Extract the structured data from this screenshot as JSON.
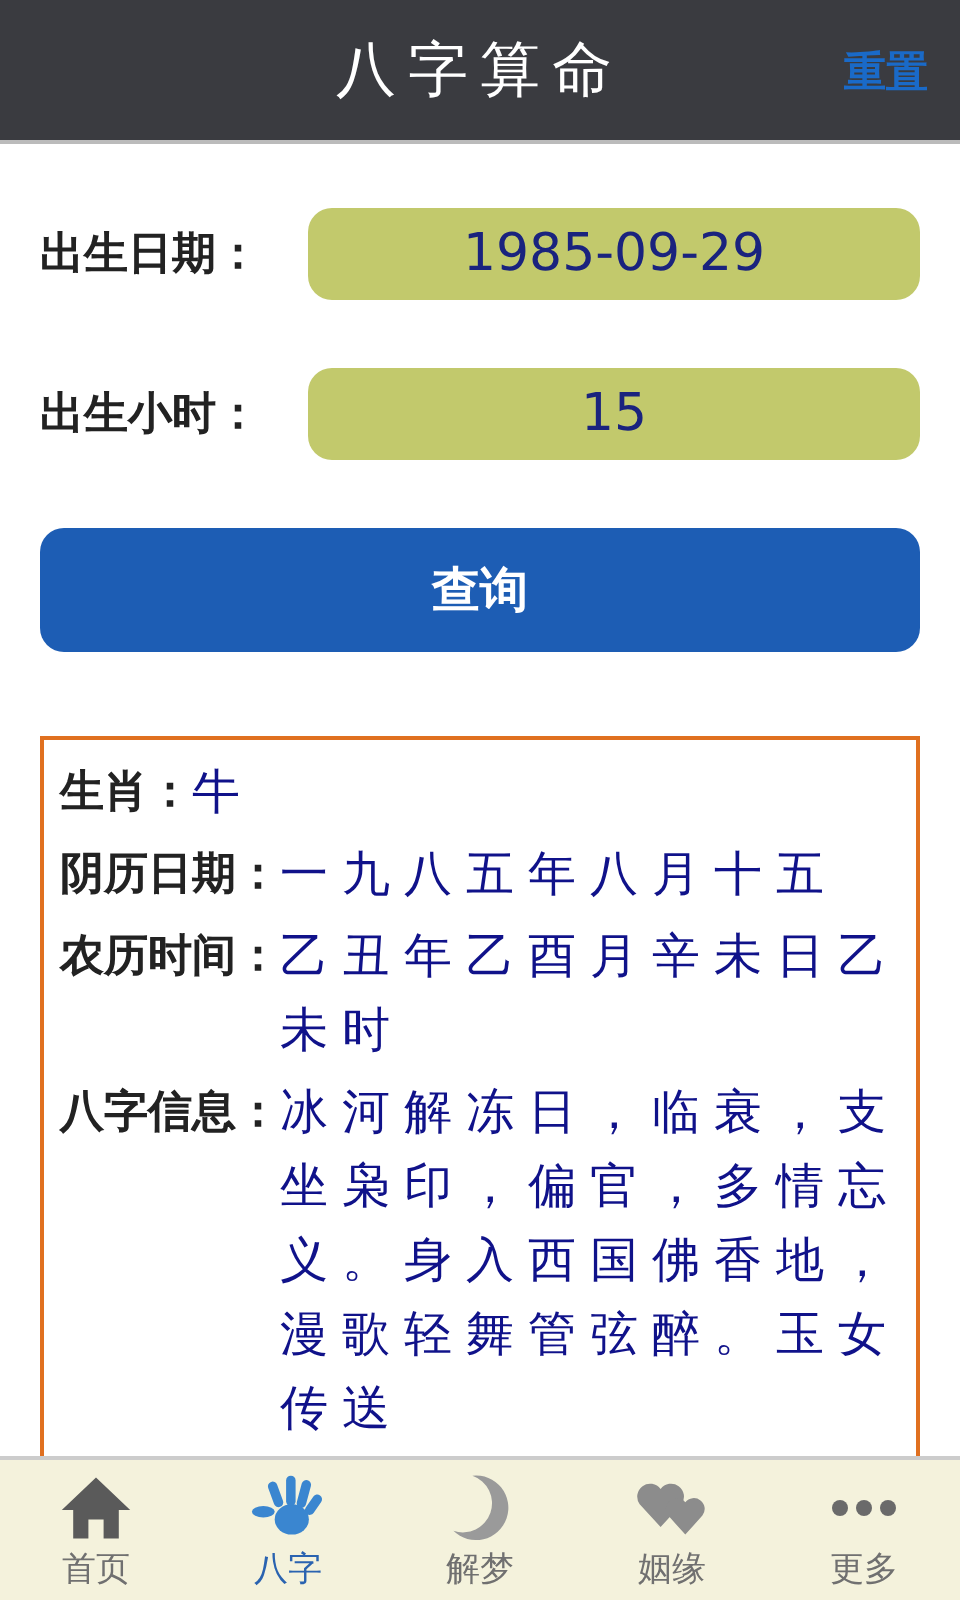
{
  "header": {
    "title": "八字算命",
    "reset": "重置"
  },
  "form": [
    {
      "label": "出生日期：",
      "value": "1985-09-29"
    },
    {
      "label": "出生小时：",
      "value": "15"
    }
  ],
  "submit": "查询",
  "result": [
    {
      "label": "生肖：",
      "value": "牛"
    },
    {
      "label": "阴历日期：",
      "value": "一九八五年八月十五"
    },
    {
      "label": "农历时间：",
      "value": "乙丑年乙酉月辛未日乙未时"
    },
    {
      "label": "八字信息：",
      "value": "冰河解冻日，临衰，支坐枭印，偏官，多情忘义。身入西国佛香地，漫歌轻舞管弦醉。玉女传送"
    }
  ],
  "tabs": [
    {
      "label": "首页",
      "kind": "home",
      "selected": false
    },
    {
      "label": "八字",
      "kind": "hand",
      "selected": true
    },
    {
      "label": "解梦",
      "kind": "moon",
      "selected": false
    },
    {
      "label": "姻缘",
      "kind": "hearts",
      "selected": false
    },
    {
      "label": "更多",
      "kind": "more",
      "selected": false
    }
  ]
}
